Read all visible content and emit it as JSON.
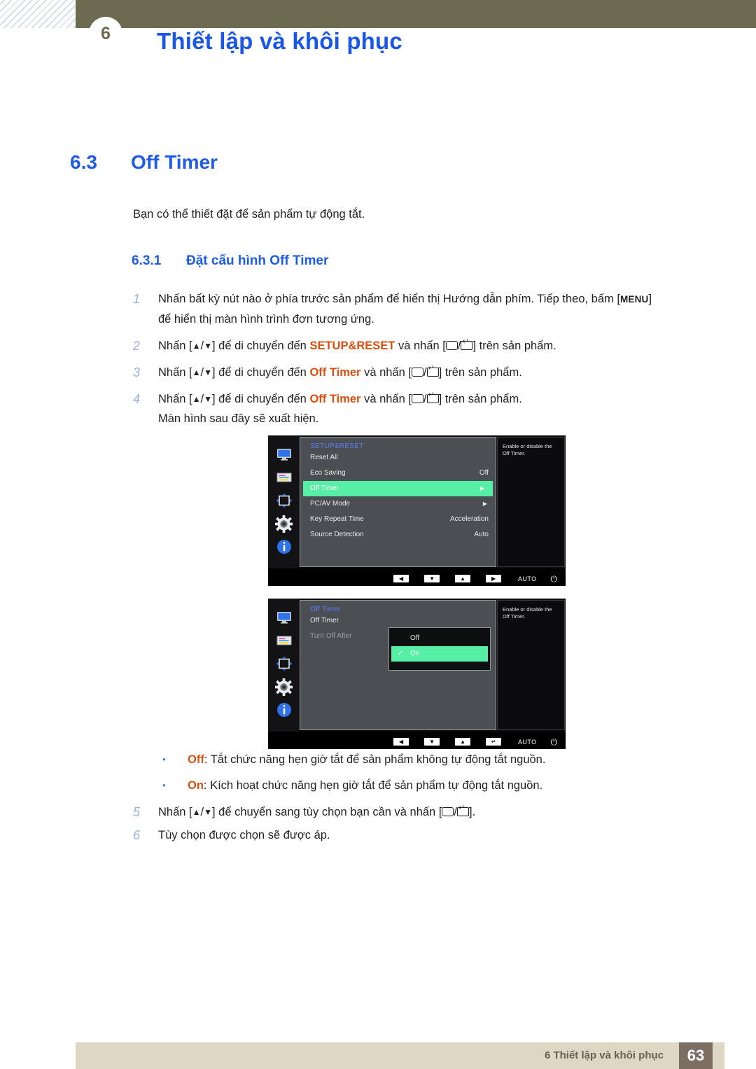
{
  "header": {
    "chapter_number": "6",
    "title": "Thiết lập và khôi phục",
    "bar_color": "#6d6a52",
    "title_color": "#1a56e8"
  },
  "section": {
    "number": "6.3",
    "title": "Off Timer",
    "intro": "Bạn có thể thiết đặt để sản phẩm tự động tắt.",
    "sub_number": "6.3.1",
    "sub_title": "Đặt cấu hình Off Timer",
    "heading_color": "#1f5be8"
  },
  "steps": [
    {
      "n": "1",
      "line1_a": "Nhấn bất kỳ nút nào ở phía trước sản phẩm để hiển thị Hướng dẫn phím. Tiếp theo, bấm [",
      "key": "MENU",
      "line1_b": "]",
      "line2": "để hiển thị màn hình trình đơn tương ứng."
    },
    {
      "n": "2",
      "a": "Nhấn [",
      "up": "▲",
      "slash": "/",
      "down": "▼",
      "b": "] để di chuyển đến ",
      "target": "SETUP&RESET",
      "c": " và nhấn [",
      "d": "/",
      "e": "] trên sản phẩm."
    },
    {
      "n": "3",
      "a": "Nhấn [",
      "up": "▲",
      "slash": "/",
      "down": "▼",
      "b": "] để di chuyển đến ",
      "target": "Off Timer",
      "c": " và nhấn [",
      "d": "/",
      "e": "] trên sản phẩm."
    },
    {
      "n": "4",
      "a": "Nhấn [",
      "up": "▲",
      "slash": "/",
      "down": "▼",
      "b": "] để di chuyển đến ",
      "target": "Off Timer",
      "c": " và nhấn [",
      "d": "/",
      "e": "] trên sản phẩm.",
      "extra": "Màn hình sau đây sẽ xuất hiện."
    }
  ],
  "steps_tail": [
    {
      "n": "5",
      "a": "Nhấn [",
      "up": "▲",
      "slash": "/",
      "down": "▼",
      "b": "] để chuyển sang tùy chọn bạn cần và nhấn [",
      "d": "/",
      "e": "]."
    },
    {
      "n": "6",
      "a": "Tùy chọn được chọn sẽ được áp."
    }
  ],
  "bullets": [
    {
      "marker": "•",
      "label": "Off",
      "text": ": Tắt chức năng hẹn giờ tắt để sản phẩm không tự động tắt nguồn."
    },
    {
      "marker": "•",
      "label": "On",
      "text": ": Kích hoạt chức năng hẹn giờ tắt để sản phẩm tự động tắt nguồn."
    }
  ],
  "osd1": {
    "menu_title": "SETUP&RESET",
    "rows": [
      {
        "label": "Reset All",
        "value": "",
        "arrow": ""
      },
      {
        "label": "Eco Saving",
        "value": "Off",
        "arrow": ""
      },
      {
        "label": "Off Timer",
        "value": "",
        "arrow": "▶",
        "selected": true
      },
      {
        "label": "PC/AV Mode",
        "value": "",
        "arrow": "▶"
      },
      {
        "label": "Key Repeat Time",
        "value": "Acceleration",
        "arrow": ""
      },
      {
        "label": "Source Detection",
        "value": "Auto",
        "arrow": ""
      }
    ],
    "help_line1": "Enable or disable the",
    "help_line2": "Off Timer.",
    "nav": {
      "left": "◀",
      "down": "▼",
      "up": "▲",
      "fourth": "▶",
      "auto": "AUTO",
      "power": "⏻"
    },
    "highlight_color": "#57efa6"
  },
  "osd2": {
    "menu_title": "Off Timer",
    "rows": [
      {
        "label": "Off Timer",
        "dim": false
      },
      {
        "label": "Turn Off After",
        "dim": true
      }
    ],
    "options": [
      {
        "label": "Off",
        "checked": false
      },
      {
        "label": "On",
        "checked": true,
        "check": "✓"
      }
    ],
    "help_line1": "Enable or disable the",
    "help_line2": "Off Timer.",
    "nav": {
      "left": "◀",
      "down": "▼",
      "up": "▲",
      "fourth": "↵",
      "auto": "AUTO",
      "power": "⏻"
    },
    "highlight_color": "#57efa6"
  },
  "footer": {
    "text": "6 Thiết lập và khôi phục",
    "page": "63",
    "bar_color": "#ddd7c4",
    "page_box_color": "#7d6e63"
  }
}
